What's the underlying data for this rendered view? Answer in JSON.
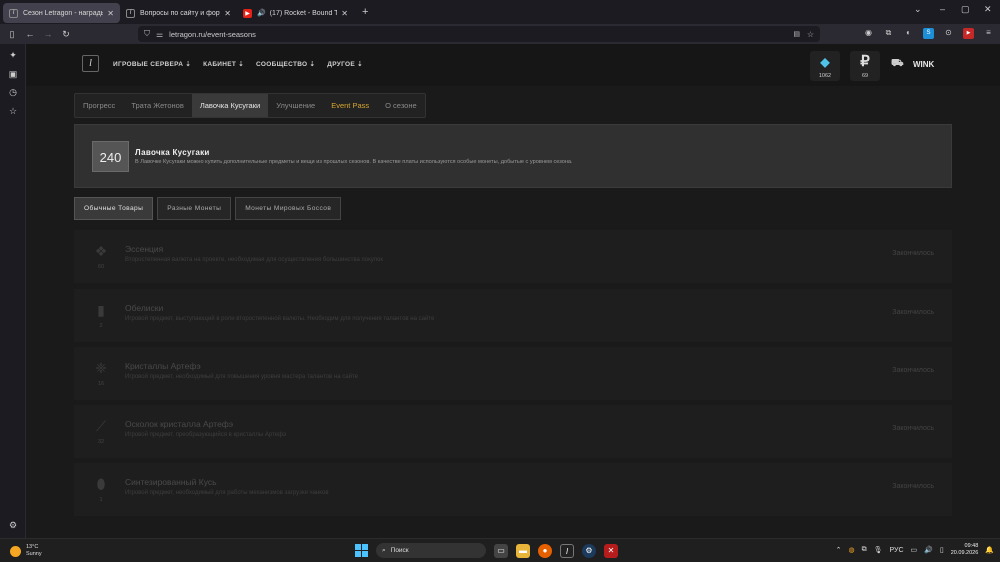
{
  "browser": {
    "tabs": [
      {
        "title": "Сезон Letragon - награды за а",
        "favicon": "L",
        "active": true
      },
      {
        "title": "Вопросы по сайту и форуму -",
        "favicon": "L",
        "active": false
      },
      {
        "title": "(17) Rocket - Bound Thug (",
        "favicon": "youtube",
        "active": false
      }
    ],
    "url": "letragon.ru/event-seasons"
  },
  "site": {
    "nav": [
      "ИГРОВЫЕ СЕРВЕРА ⇣",
      "КАБИНЕТ ⇣",
      "СООБЩЕСТВО ⇣",
      "ДРУГОЕ ⇣"
    ],
    "currency1": {
      "value": "1062"
    },
    "currency2": {
      "symbol": "₽",
      "value": "69"
    },
    "user": "WINK"
  },
  "subtabs": [
    "Прогресс",
    "Трата Жетонов",
    "Лавочка Кусугаки",
    "Улучшение",
    "Event Pass",
    "О сезоне"
  ],
  "info": {
    "level": "240",
    "title": "Лавочка Кусугаки",
    "desc": "В Лавочке Кусугаки можно купить дополнительные предметы и вещи из прошлых сезонов. В качестве платы используются особые монеты, добытые с уровнем сезона."
  },
  "categories": [
    "Обычные Товары",
    "Разные Монеты",
    "Монеты Мировых Боссов"
  ],
  "items": [
    {
      "name": "Эссенция",
      "desc": "Второстепенная валюта на проекте, необходимая для осуществления большинства покупок",
      "qty": "60",
      "status": "Закончилось"
    },
    {
      "name": "Обелиски",
      "desc": "Игровой предмет, выступающий в роли второстепенной валюты. Необходим для получения талантов на сайте",
      "qty": "2",
      "status": "Закончилось"
    },
    {
      "name": "Кристаллы Артефэ",
      "desc": "Игровой предмет, необходимый для повышения уровня мастера талантов на сайте",
      "qty": "16",
      "status": "Закончилось"
    },
    {
      "name": "Осколок кристалла Артефэ",
      "desc": "Игровой предмет, преобразующийся в кристаллы Артефэ",
      "qty": "32",
      "status": "Закончилось"
    },
    {
      "name": "Синтезированный Кусь",
      "desc": "Игровой предмет, необходимый для работы механизмов загрузки чанков",
      "qty": "1",
      "status": "Закончилось"
    }
  ],
  "taskbar": {
    "weather_temp": "13°C",
    "weather_desc": "Sunny",
    "search": "Поиск",
    "lang": "РУС",
    "time": "09:48",
    "date": "20.09.2026"
  }
}
